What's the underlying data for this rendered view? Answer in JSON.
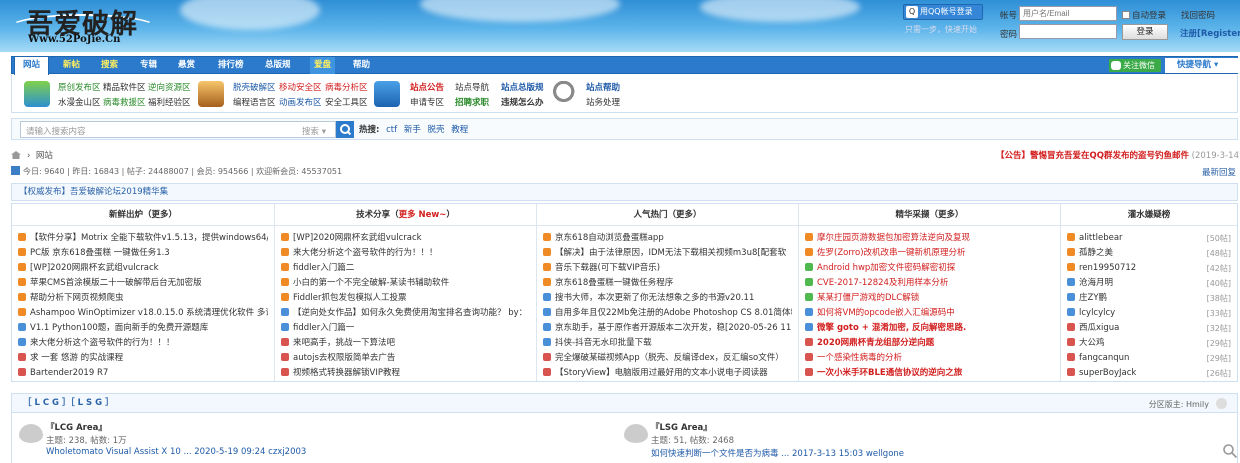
{
  "header": {
    "logo_cn": "吾爱破解",
    "logo_en": "Www.52PoJie.Cn",
    "qq_login": "用QQ帐号登录",
    "qq_sub": "只需一步，快速开始",
    "account_label": "帐号",
    "account_placeholder": "用户名/Email",
    "auto_login": "自动登录",
    "forgot": "找回密码",
    "password_label": "密码",
    "login_button": "登录",
    "register": "注册[Register]"
  },
  "nav": {
    "items": [
      "网站",
      "新帖",
      "搜索",
      "专辑",
      "悬赏",
      "排行榜",
      "总版规",
      "爱盘",
      "帮助"
    ],
    "wechat": "关注微信",
    "quick_nav": "快捷导航"
  },
  "quicklinks": {
    "groups": [
      {
        "icon": "plant-icon",
        "lines": [
          [
            "原创发布区",
            "精品软件区",
            "逆向资源区"
          ],
          [
            "水漫金山区",
            "病毒救援区",
            "福利经验区"
          ]
        ]
      },
      {
        "icon": "box-icon",
        "lines": [
          [
            "脱壳破解区",
            "移动安全区",
            "病毒分析区"
          ],
          [
            "编程语言区",
            "动画发布区",
            "安全工具区"
          ]
        ]
      },
      {
        "icon": "house-icon",
        "lines": [
          [
            "站点公告",
            "站点导航"
          ],
          [
            "申请专区",
            "招聘求职"
          ]
        ]
      },
      {
        "icon": "magnifier-icon",
        "lines": [
          [
            "站点总版规",
            "站点帮助"
          ],
          [
            "违规怎么办",
            "站务处理"
          ]
        ]
      }
    ]
  },
  "search": {
    "placeholder": "请输入搜索内容",
    "scope": "搜索",
    "hot_label": "热搜:",
    "hot": [
      "ctf",
      "新手",
      "脱壳",
      "教程"
    ]
  },
  "breadcrumb": "网站",
  "notice": {
    "text": "【公告】警惕冒充吾爱在QQ群发布的盗号钓鱼邮件",
    "date": "(2019-3-14)"
  },
  "stats": "今日: 9640 | 昨日: 16843 | 帖子: 24488007 | 会员: 954566 | 欢迎新会员: 45537051",
  "latest_reply": "最新回复",
  "release": "【权威发布】吾爱破解论坛2019精华集",
  "columns": [
    {
      "title": "新鲜出炉（更多）",
      "items": [
        "【软件分享】Motrix 全能下载软件v1.5.13，提供windows64/32",
        "PC版 京东618叠蛋糕 一键做任务1.3",
        "[WP]2020网鼎杯玄武组vulcrack",
        "苹果CMS首涂模版二十一破解带后台无加密版",
        "帮助分析下网页视频爬虫",
        "Ashampoo WinOptimizer v18.0.15.0 系统清理优化软件 多语言",
        "V1.1 Python100题，面向新手的免费开源题库",
        "来大佬分析这个盗号软件的行为！！！",
        "求 一套 悠游 的实战课程",
        "Bartender2019 R7"
      ]
    },
    {
      "title": "技术分享（更多 New~）",
      "items": [
        "[WP]2020网鼎杯玄武组vulcrack",
        "来大佬分析这个盗号软件的行为！！！",
        "fiddler入门篇二",
        "小白的第一个不完全破解-某读书辅助软件",
        "Fiddler抓包发包模拟人工投票",
        "【逆向处女作品】如何永久免费使用淘宝排名查询功能？ by：",
        "fiddler入门篇一",
        "来吧高手，挑战一下算法吧",
        "autojs去权限版简单去广告",
        "视频格式转换器解锁VIP教程"
      ]
    },
    {
      "title": "人气热门（更多）",
      "items": [
        "京东618自动浏览叠蛋糕app",
        "【解决】由于法律原因，IDM无法下载相关视频m3u8[配套软",
        "音乐下载器(可下载VIP音乐)",
        "京东618叠蛋糕一键做任务程序",
        "搜书大师，本次更新了你无法想象之多的书源v20.11",
        "自用多年且仅22Mb免注册的Adobe Photoshop CS 8.01简体精",
        "京东助手，基于原作者开源版本二次开发，稳[2020-05-26 11:5",
        "抖侠-抖音无水印批量下载",
        "完全爆破某磁视频App（脱壳、反编译dex，反汇编so文件）",
        "【StoryView】电脑版用过最好用的文本小说电子阅读器"
      ]
    },
    {
      "title": "精华采撷（更多）",
      "items": [
        "摩尔庄园页游数据包加密算法逆向及复现",
        "佐罗(Zorro)改机改串一键新机原理分析",
        "Android hwp加密文件密码解密初探",
        "CVE-2017-12824及利用样本分析",
        "某某打僵尸游戏的DLC解锁",
        "如何将VM的opcode嵌入汇编源码中",
        "微擎 goto + 混淆加密, 反向解密思路.",
        "2020网鼎杯青龙组部分逆向题",
        "一个感染性病毒的分析",
        "一次小米手环BLE通信协议的逆向之旅"
      ]
    },
    {
      "title": "灌水嫌疑榜",
      "items": [
        "alittlebear",
        "孤静之美",
        "ren19950712",
        "沧海月明",
        "庄ZY鹏",
        "lcylcylcy",
        "西瓜xigua",
        "大公鸡",
        "fangcanqun",
        "superBoyJack"
      ],
      "counts": [
        "[50帖]",
        "[48帖]",
        "[42帖]",
        "[40帖]",
        "[38帖]",
        "[33帖]",
        "[32帖]",
        "[29帖]",
        "[29帖]",
        "[26帖]"
      ]
    }
  ],
  "section": {
    "title": "［ L C G ］［ L S G ］",
    "moderator": "分区版主: Hmily",
    "forums": [
      {
        "name": "『LCG Area』",
        "stats": "主题: 238, 帖数: 1万",
        "last": "Wholetomato Visual Assist X 10 ... 2020-5-19 09:24 czxj2003"
      },
      {
        "name": "『LSG Area』",
        "stats": "主题: 51, 帖数: 2468",
        "last": "如何快速判断一个文件是否为病毒 ... 2017-3-13 15:03 wellgone"
      }
    ]
  }
}
